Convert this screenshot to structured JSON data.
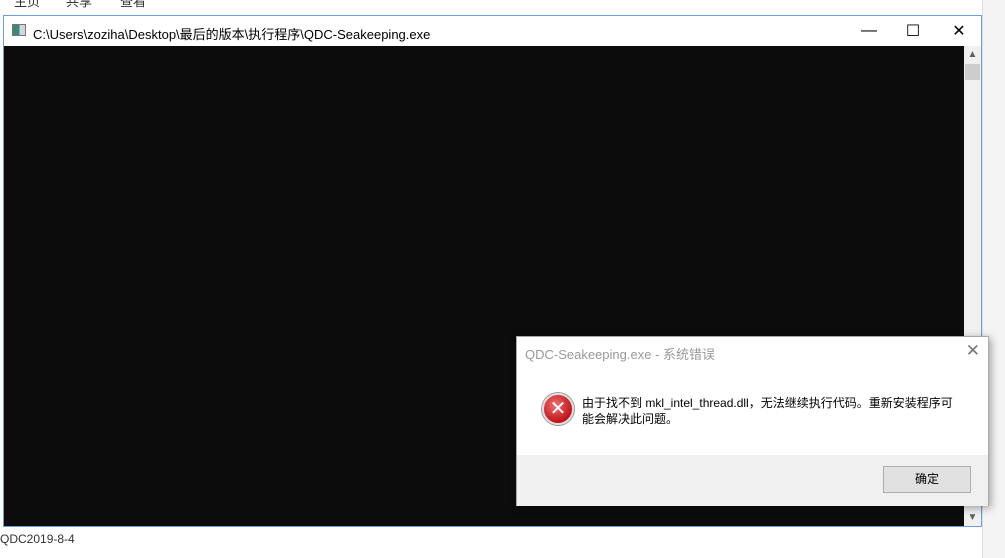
{
  "ribbon": {
    "tabs": [
      "主页",
      "共享",
      "查看"
    ]
  },
  "window": {
    "title": "C:\\Users\\zoziha\\Desktop\\最后的版本\\执行程序\\QDC-Seakeeping.exe",
    "minimize": "—",
    "maximize": "☐",
    "close": "✕"
  },
  "scrollbar": {
    "up": "▲",
    "down": "▼"
  },
  "dialog": {
    "title": "QDC-Seakeeping.exe - 系统错误",
    "close": "✕",
    "icon": "error-icon",
    "message": "由于找不到 mkl_intel_thread.dll，无法继续执行代码。重新安装程序可能会解决此问题。",
    "ok": "确定"
  },
  "footer": {
    "text": "QDC2019-8-4"
  }
}
